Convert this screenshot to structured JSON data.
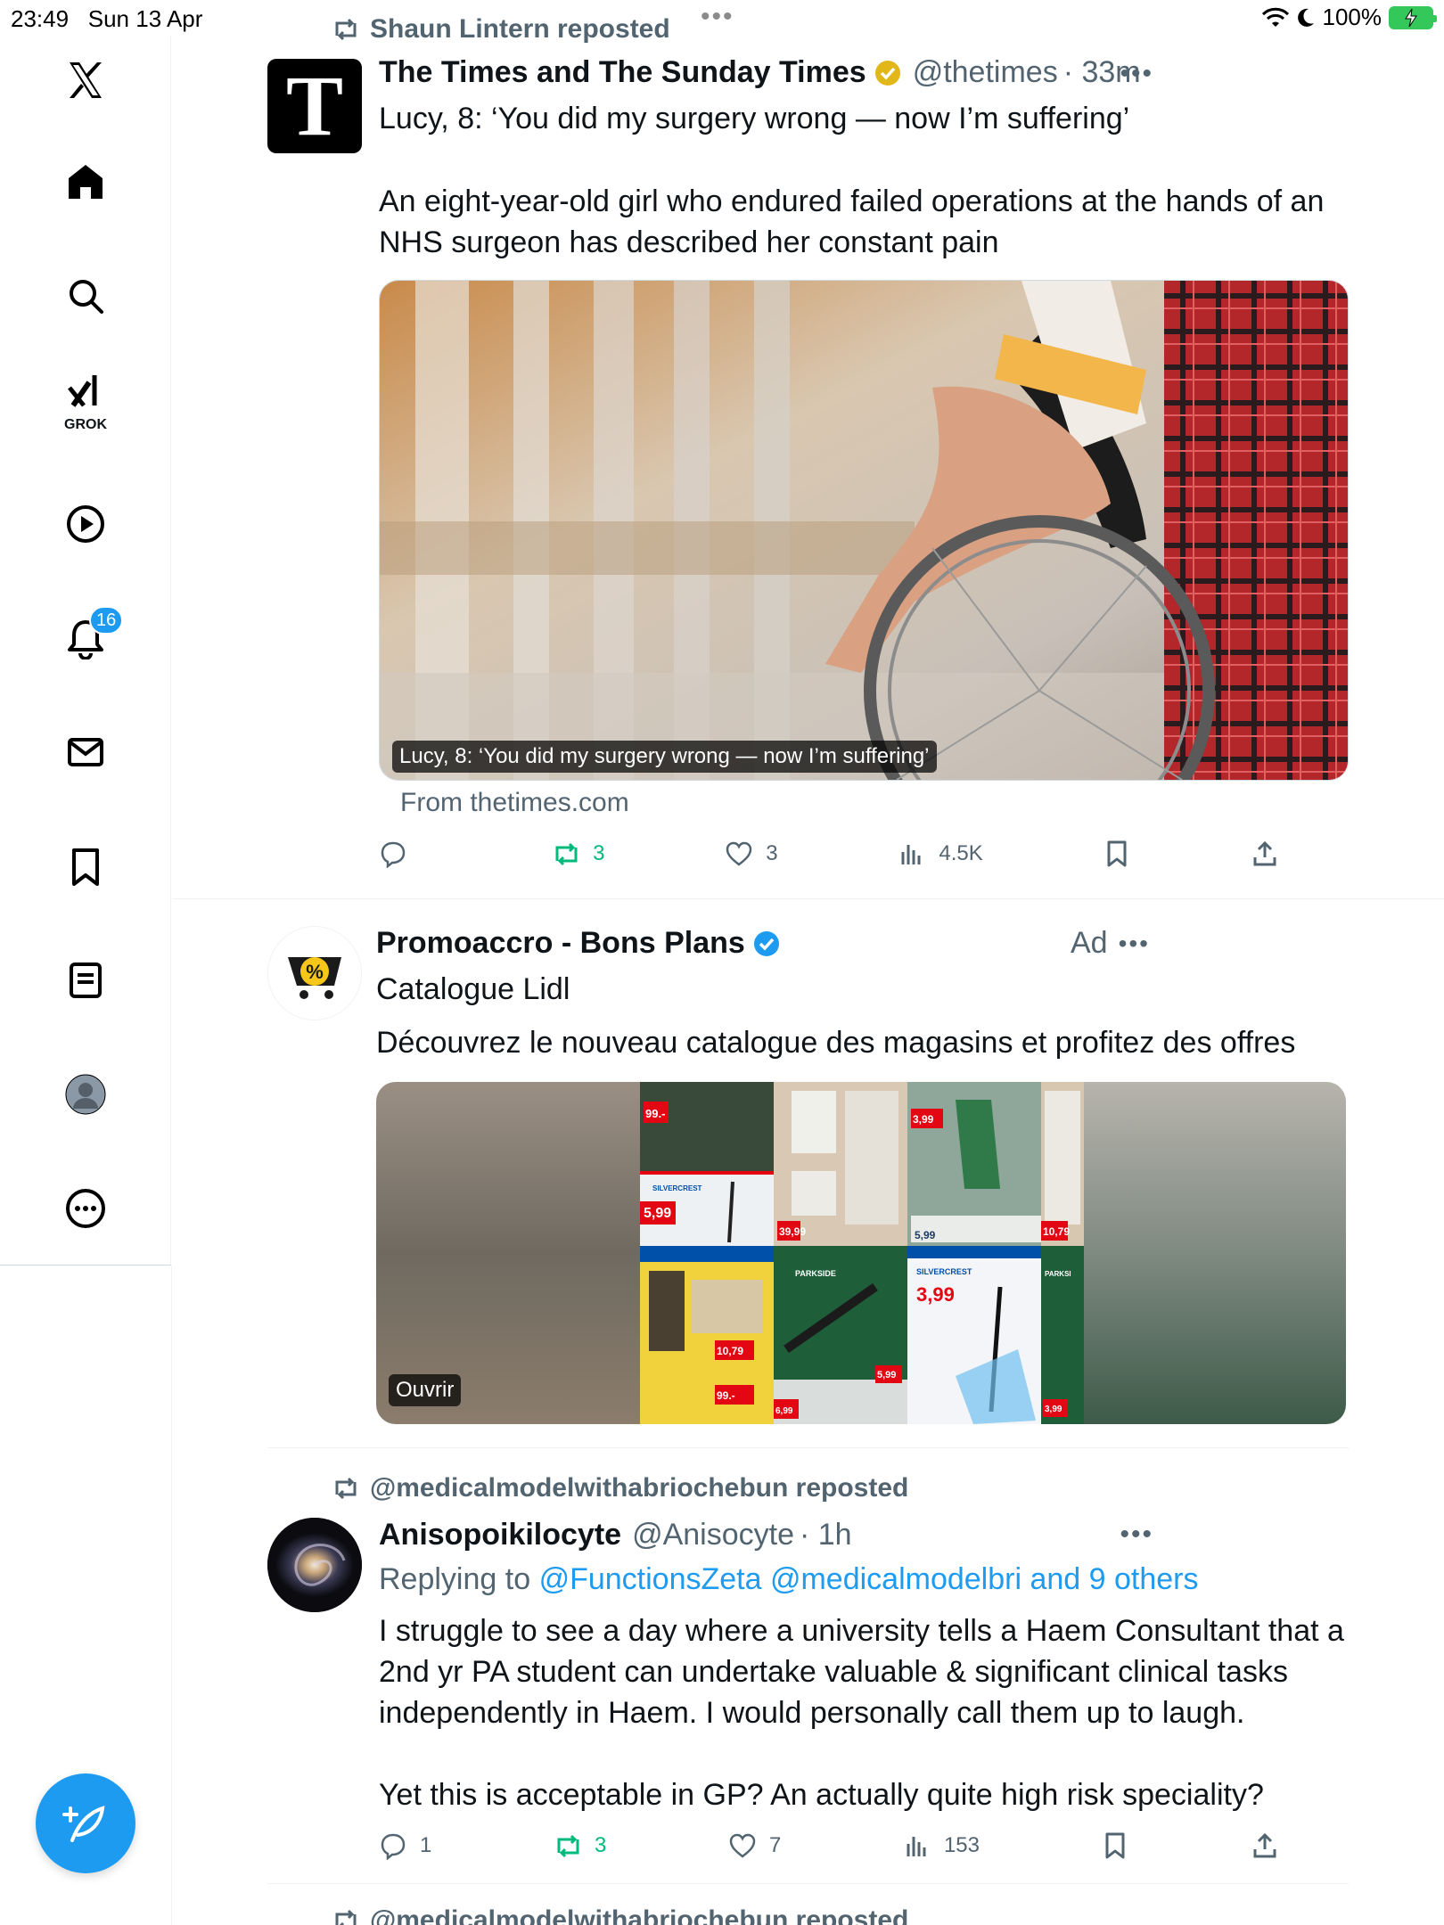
{
  "status_bar": {
    "time": "23:49",
    "date": "Sun 13 Apr",
    "battery": "100%"
  },
  "sidebar": {
    "items": [
      {
        "name": "x-logo"
      },
      {
        "name": "home"
      },
      {
        "name": "search"
      },
      {
        "name": "grok",
        "label": "GROK"
      },
      {
        "name": "video"
      },
      {
        "name": "notifications",
        "badge": "16"
      },
      {
        "name": "messages"
      },
      {
        "name": "bookmarks"
      },
      {
        "name": "lists"
      },
      {
        "name": "profile"
      },
      {
        "name": "more"
      }
    ]
  },
  "posts": [
    {
      "repost_by": "Shaun Lintern reposted",
      "name": "The Times and The Sunday Times",
      "handle": "@thetimes",
      "time": "· 33m",
      "headline": "Lucy, 8: ‘You did my surgery wrong — now I’m suffering’",
      "body": "An eight-year-old girl who endured failed operations at the hands of an NHS surgeon has described her constant pain",
      "card_caption": "Lucy, 8: ‘You did my surgery wrong — now I’m suffering’",
      "card_source": "From thetimes.com",
      "stats": {
        "replies": "",
        "reposts": "3",
        "likes": "3",
        "views": "4.5K"
      }
    },
    {
      "name": "Promoaccro - Bons Plans",
      "ad": "Ad",
      "headline": "Catalogue Lidl",
      "body": "Découvrez le nouveau catalogue des magasins et profitez des offres",
      "open_label": "Ouvrir",
      "prices": [
        "99.-",
        "5,99",
        "39,99",
        "3,99",
        "5,99",
        "10,79",
        "10,79",
        "99.-",
        "5,99",
        "3,99",
        "6,99",
        "3,99"
      ],
      "brands": [
        "SILVERCREST",
        "PARKSIDE",
        "SILVERCREST",
        "PARKSI"
      ]
    },
    {
      "repost_by": "@medicalmodelwithabriochebun reposted",
      "name": "Anisopoikilocyte",
      "handle": "@Anisocyte",
      "time": "· 1h",
      "replying_prefix": "Replying to",
      "replying_to": "@FunctionsZeta @medicalmodelbri and 9 others",
      "body1": "I struggle to see a day where a university tells a Haem Consultant that a 2nd yr PA student can undertake valuable & significant clinical tasks independently in Haem. I would personally call them up to laugh.",
      "body2": "Yet this is acceptable in GP? An actually quite high risk speciality?",
      "stats": {
        "replies": "1",
        "reposts": "3",
        "likes": "7",
        "views": "153"
      }
    },
    {
      "repost_by": "@medicalmodelwithabriochebun reposted"
    }
  ]
}
